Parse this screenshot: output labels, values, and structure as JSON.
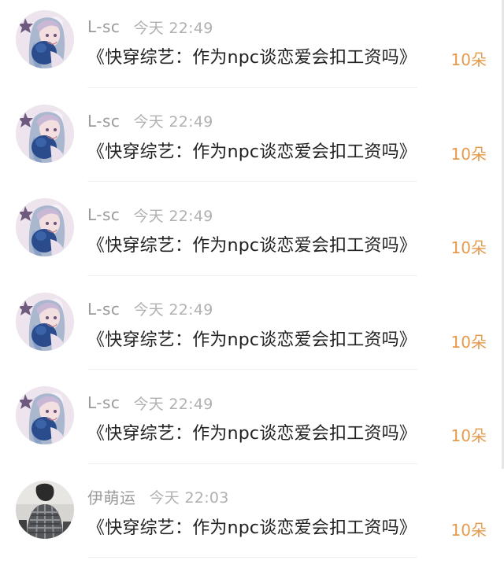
{
  "feed": {
    "items": [
      {
        "username": "L-sc",
        "time": "今天 22:49",
        "title": "《快穿综艺：作为npc谈恋爱会扣工资吗》",
        "gift": "10朵",
        "avatar_icon": "anime-girl-avatar"
      },
      {
        "username": "L-sc",
        "time": "今天 22:49",
        "title": "《快穿综艺：作为npc谈恋爱会扣工资吗》",
        "gift": "10朵",
        "avatar_icon": "anime-girl-avatar"
      },
      {
        "username": "L-sc",
        "time": "今天 22:49",
        "title": "《快穿综艺：作为npc谈恋爱会扣工资吗》",
        "gift": "10朵",
        "avatar_icon": "anime-girl-avatar"
      },
      {
        "username": "L-sc",
        "time": "今天 22:49",
        "title": "《快穿综艺：作为npc谈恋爱会扣工资吗》",
        "gift": "10朵",
        "avatar_icon": "anime-girl-avatar"
      },
      {
        "username": "L-sc",
        "time": "今天 22:49",
        "title": "《快穿综艺：作为npc谈恋爱会扣工资吗》",
        "gift": "10朵",
        "avatar_icon": "anime-girl-avatar"
      },
      {
        "username": "伊萌运",
        "time": "今天 22:03",
        "title": "《快穿综艺：作为npc谈恋爱会扣工资吗》",
        "gift": "10朵",
        "avatar_icon": "plaid-coat-photo-avatar"
      }
    ]
  },
  "colors": {
    "username": "#9a9a9a",
    "time": "#b0b0b0",
    "title": "#222222",
    "gift_accent": "#e69a4c",
    "divider": "#f0f0f0"
  }
}
